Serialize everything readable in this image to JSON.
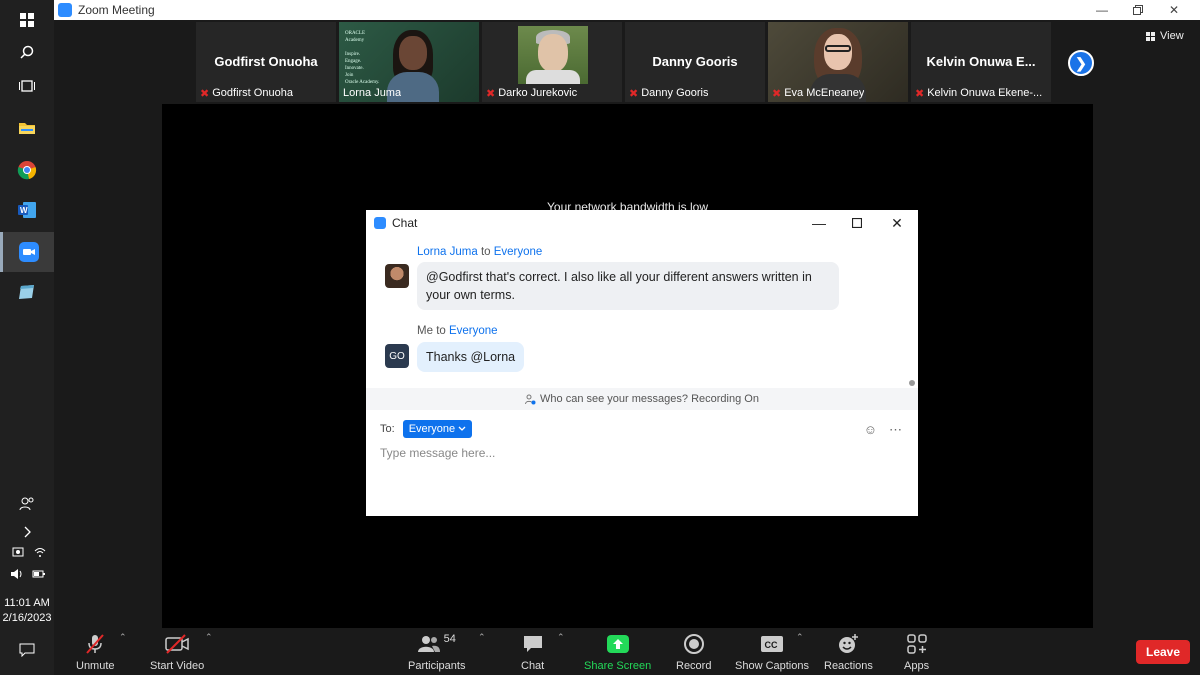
{
  "window": {
    "title": "Zoom Meeting"
  },
  "taskbar": {
    "time": "11:01 AM",
    "date": "2/16/2023"
  },
  "gallery": [
    {
      "big_name": "Godfirst Onuoha",
      "name": "Godfirst Onuoha",
      "video": false
    },
    {
      "big_name": "",
      "name": "Lorna Juma",
      "video": true
    },
    {
      "big_name": "",
      "name": "Darko Jurekovic",
      "video": true
    },
    {
      "big_name": "Danny Gooris",
      "name": "Danny Gooris",
      "video": false
    },
    {
      "big_name": "",
      "name": "Eva McEneaney",
      "video": true
    },
    {
      "big_name": "Kelvin Onuwa E...",
      "name": "Kelvin Onuwa Ekene-...",
      "video": false
    }
  ],
  "view_label": "View",
  "share": {
    "notice": "Your network bandwidth is low"
  },
  "chat": {
    "title": "Chat",
    "messages": [
      {
        "sender": "Lorna Juma",
        "to_word": "to",
        "recipient": "Everyone",
        "text": "@Godfirst that's correct. I also like all your different answers written in your own terms."
      },
      {
        "sender": "Me",
        "to_word": "to",
        "recipient": "Everyone",
        "avatar_initials": "GO",
        "text": "Thanks @Lorna"
      }
    ],
    "privacy_text": "Who can see your messages? Recording On",
    "to_label": "To:",
    "to_value": "Everyone",
    "input_placeholder": "Type message here..."
  },
  "controls": {
    "unmute": "Unmute",
    "start_video": "Start Video",
    "participants": "Participants",
    "participants_count": "54",
    "chat": "Chat",
    "share_screen": "Share Screen",
    "record": "Record",
    "show_captions": "Show Captions",
    "reactions": "Reactions",
    "apps": "Apps",
    "leave": "Leave"
  },
  "colors": {
    "accent": "#0e72ed",
    "share_green": "#23d959",
    "leave_red": "#e02828"
  }
}
